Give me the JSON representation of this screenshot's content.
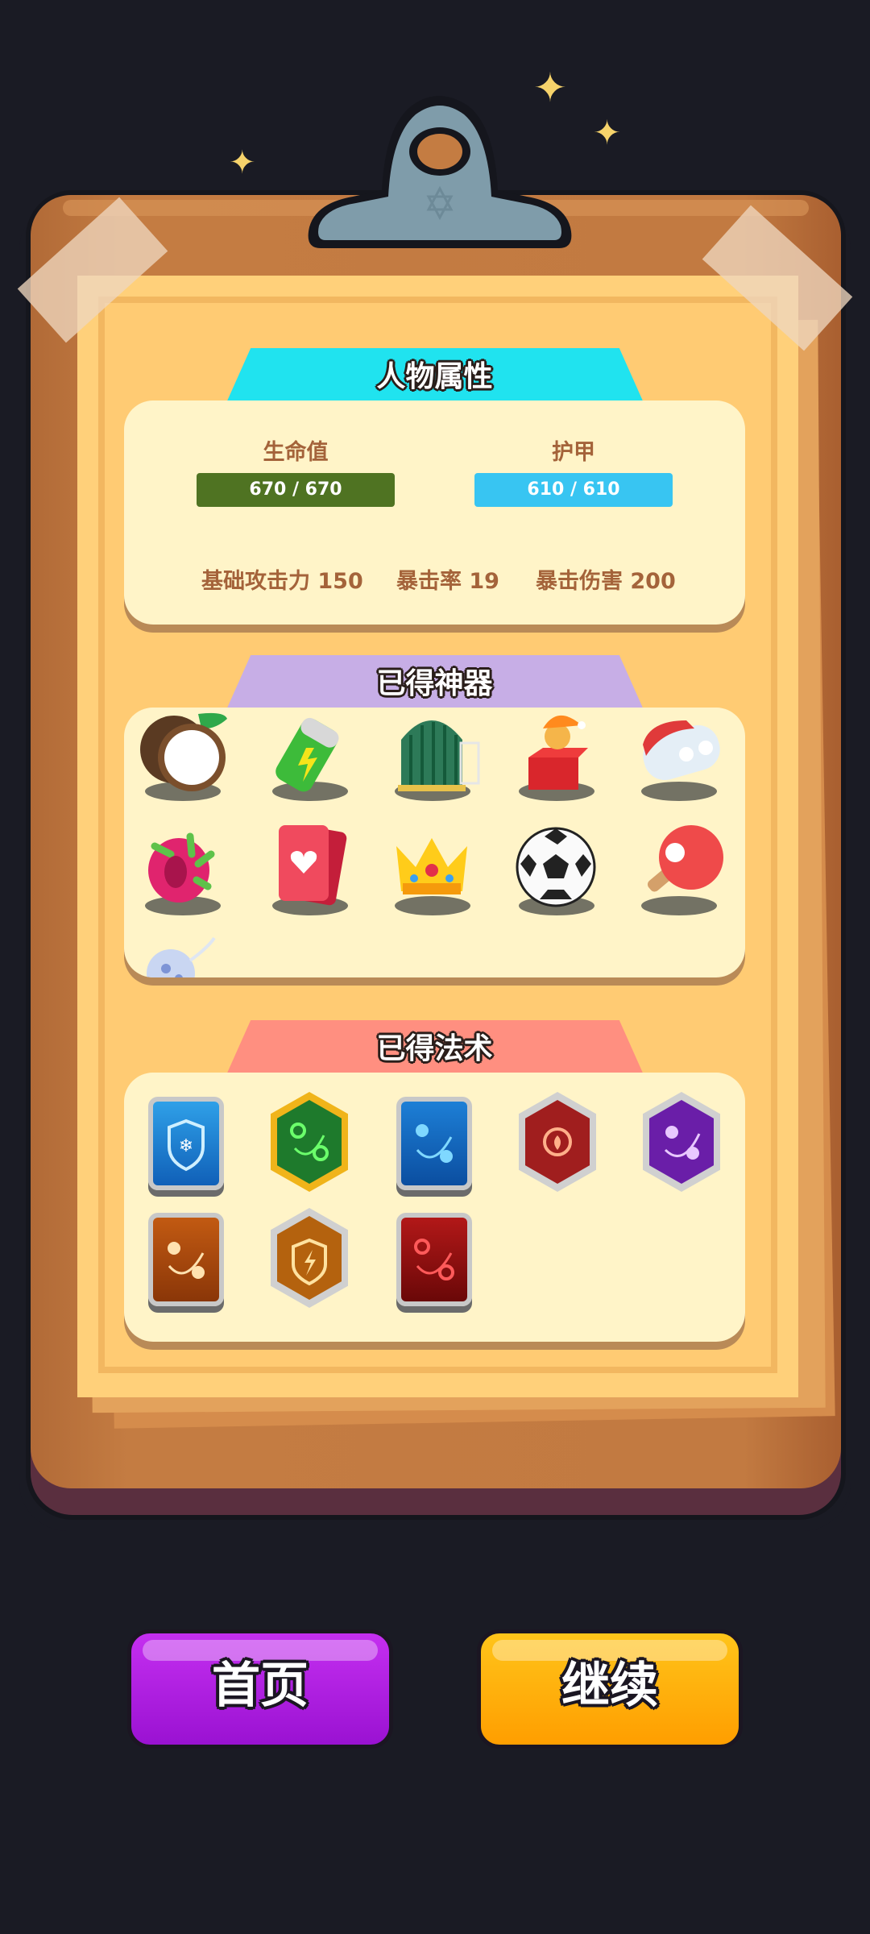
{
  "stats": {
    "title": "人物属性",
    "hp_label": "生命值",
    "hp_value": "670 / 670",
    "armor_label": "护甲",
    "armor_value": "610 / 610",
    "attack": "基础攻击力 150",
    "crit_rate": "暴击率 19",
    "crit_damage": "暴击伤害 200",
    "hp_fraction": 1.0,
    "armor_fraction": 1.0,
    "colors": {
      "hp_bar": "#4f7322",
      "armor_bar": "#38c5f2",
      "tab": "#20e3ef"
    }
  },
  "artifacts": {
    "title": "已得神器",
    "tab_color": "#c7aee6",
    "items": [
      "coconut-icon",
      "battery-icon",
      "birdcage-icon",
      "jester-box-icon",
      "earbuds-case-icon",
      "dragon-fruit-icon",
      "heart-cards-icon",
      "crown-icon",
      "soccer-ball-icon",
      "ping-pong-paddle-icon",
      "crystal-orb-icon"
    ]
  },
  "spells": {
    "title": "已得法术",
    "tab_color": "#ff8f80",
    "items": [
      "ice-shield-rune-icon",
      "green-orbit-rune-icon",
      "blue-orbit-rune-icon",
      "fire-rune-icon",
      "purple-orbit-rune-icon",
      "orange-orbit-rune-icon",
      "lightning-shield-rune-icon",
      "red-orbit-rune-icon"
    ]
  },
  "buttons": {
    "home": "首页",
    "continue": "继续",
    "home_color": "#b41ee6",
    "continue_color": "#ffab00"
  }
}
